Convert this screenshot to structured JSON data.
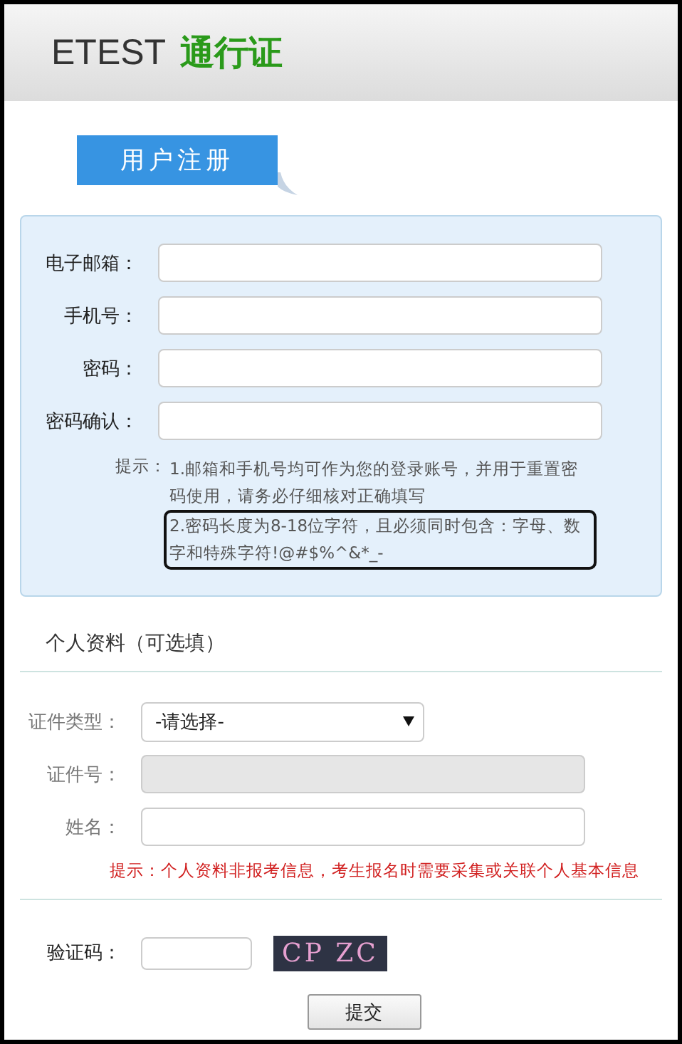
{
  "header": {
    "brand": "ETEST",
    "brand_cn": "通行证"
  },
  "tab": {
    "label": "用户注册"
  },
  "account_fields": [
    {
      "label": "电子邮箱："
    },
    {
      "label": "手机号："
    },
    {
      "label": "密码："
    },
    {
      "label": "密码确认："
    }
  ],
  "hint": {
    "prefix": "提示：",
    "line_1": "1.邮箱和手机号均可作为您的登录账号，并用于重置密码使用，请务必仔细核对正确填写",
    "line_2": "2.密码长度为8-18位字符，且必须同时包含：字母、数字和特殊字符!@#$%^&*_-"
  },
  "personal": {
    "title": "个人资料（可选填）",
    "fields": [
      {
        "kind": "select",
        "label": "证件类型：",
        "value": "-请选择-",
        "disabled": false
      },
      {
        "kind": "input",
        "label": "证件号：",
        "disabled": true
      },
      {
        "kind": "input",
        "label": "姓名：",
        "disabled": false
      }
    ],
    "notice": "提示：个人资料非报考信息，考生报名时需要采集或关联个人基本信息"
  },
  "captcha": {
    "label": "验证码：",
    "code": "CP ZC"
  },
  "submit": "提交"
}
